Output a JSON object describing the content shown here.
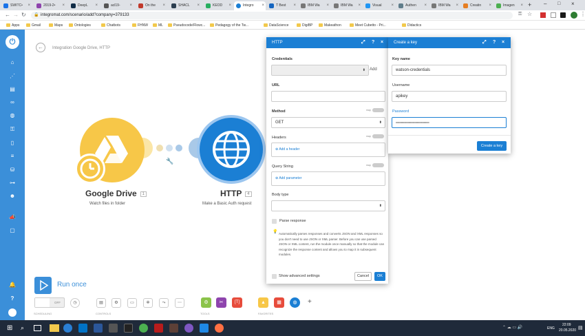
{
  "browser": {
    "tabs": [
      "SWITC•",
      "2019-2•",
      "DeepL",
      "acl19-",
      "On the",
      "SHACL",
      "KEOD",
      "Integro",
      "T Best",
      "IBM Wa",
      "IBM Wa",
      "Visual",
      "Authen",
      "IBM Wa",
      "Creatin",
      "Imagen"
    ],
    "url": "integromat.com/scenario/add?company=379133",
    "bookmarks": [
      "Apps",
      "Gmail",
      "Maps",
      "Ontologies",
      "Chatbots",
      "FHNW",
      "ML",
      "Pseudocode/Flowc...",
      "Pedagogy of the Tw...",
      "DataScience",
      "DigiBP",
      "Makeathon",
      "Meet Cubetto - Pri...",
      "Didactics"
    ]
  },
  "sidebar": {
    "icons": [
      "integromat-logo-icon",
      "home-icon",
      "share-icon",
      "team-icon",
      "link-icon",
      "globe-icon",
      "key-icon",
      "mobile-icon",
      "database-icon",
      "datastore-icon",
      "flow-icon",
      "users-icon",
      "megaphone-icon",
      "chat-icon",
      "bell-icon",
      "help-icon",
      "avatar-icon"
    ]
  },
  "breadcrumb": "Integration Google Drive, HTTP",
  "modules": {
    "gdrive": {
      "name": "Google Drive",
      "count": "1",
      "sub": "Watch files in folder"
    },
    "http": {
      "name": "HTTP",
      "count": "4",
      "sub": "Make a Basic Auth request"
    }
  },
  "bottom": {
    "run_once": "Run once",
    "off": "OFF",
    "scheduling": "SCHEDULING",
    "controls": "CONTROLS",
    "tools": "TOOLS",
    "favorites": "FAVORITES"
  },
  "http_panel": {
    "title": "HTTP",
    "credentials_label": "Credentials",
    "add_label": "Add",
    "url_label": "URL",
    "method_label": "Method",
    "method_value": "GET",
    "map": "map",
    "headers_label": "Headers",
    "add_header": "Add a header",
    "query_label": "Query String",
    "add_parameter": "Add parameter",
    "body_label": "Body type",
    "parse_label": "Parse response",
    "hint": "Automatically parses responses and converts JSON and XML responses so you don't need to use JSON or XML parser. Before you can use parsed JSON or XML content, run the module once manually so that the module can recognize the response content and allows you to map it in subsequent modules.",
    "advanced": "Show advanced settings",
    "cancel": "Cancel",
    "ok": "OK"
  },
  "key_panel": {
    "title": "Create a key",
    "keyname_label": "Key name",
    "keyname_value": "watson-credentials",
    "username_label": "Username",
    "username_value": "apikey",
    "password_label": "Password",
    "password_value": "••••••••••••••••••••••••••••••••••••••••••••",
    "create": "Create a key"
  },
  "taskbar": {
    "time": "22:09",
    "date": "20.05.2020",
    "lang": "ENG"
  },
  "colors": {
    "accent": "#1b7fd4",
    "sidebar": "#3b8fd9",
    "gdrive": "#f7c748",
    "run": "#3b8fd9",
    "tools_green": "#8bc34a",
    "tools_purple": "#8e44ad",
    "tools_red": "#e74c3c"
  }
}
